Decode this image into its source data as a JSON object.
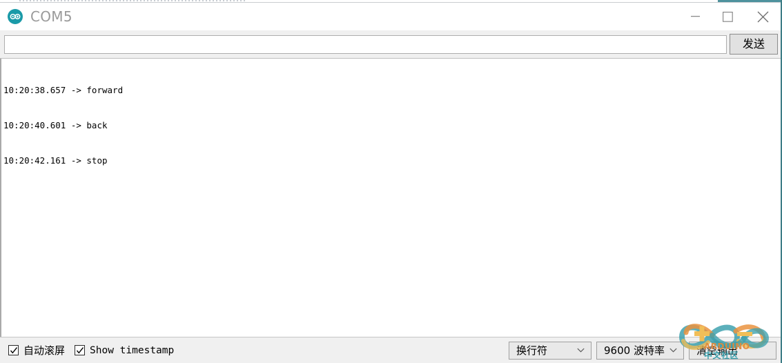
{
  "window": {
    "title": "COM5",
    "app_icon": "arduino-infinity-icon",
    "controls": {
      "minimize_label": "—",
      "maximize_label": "□",
      "close_label": "✕"
    }
  },
  "send_row": {
    "input_value": "",
    "input_placeholder": "",
    "send_label": "发送"
  },
  "console": {
    "lines": [
      "10:20:38.657 -> forward",
      "10:20:40.601 -> back",
      "10:20:42.161 -> stop"
    ]
  },
  "status_bar": {
    "autoscroll": {
      "label": "自动滚屏",
      "checked": true
    },
    "show_timestamp": {
      "label": "Show timestamp",
      "checked": true
    },
    "line_ending": {
      "selected": "换行符"
    },
    "baud_rate": {
      "selected": "9600 波特率"
    },
    "clear_output_label": "清空输出"
  },
  "watermark": {
    "line1": "ARDUINO",
    "line2": "中文社区"
  },
  "colors": {
    "accent_teal": "#1a9aa8",
    "border_teal": "#3d7d86",
    "title_text": "#9a9a9a",
    "chrome_gray": "#f0f0f0",
    "console_bg": "#ffffff",
    "watermark_orange": "#e08a3c"
  }
}
